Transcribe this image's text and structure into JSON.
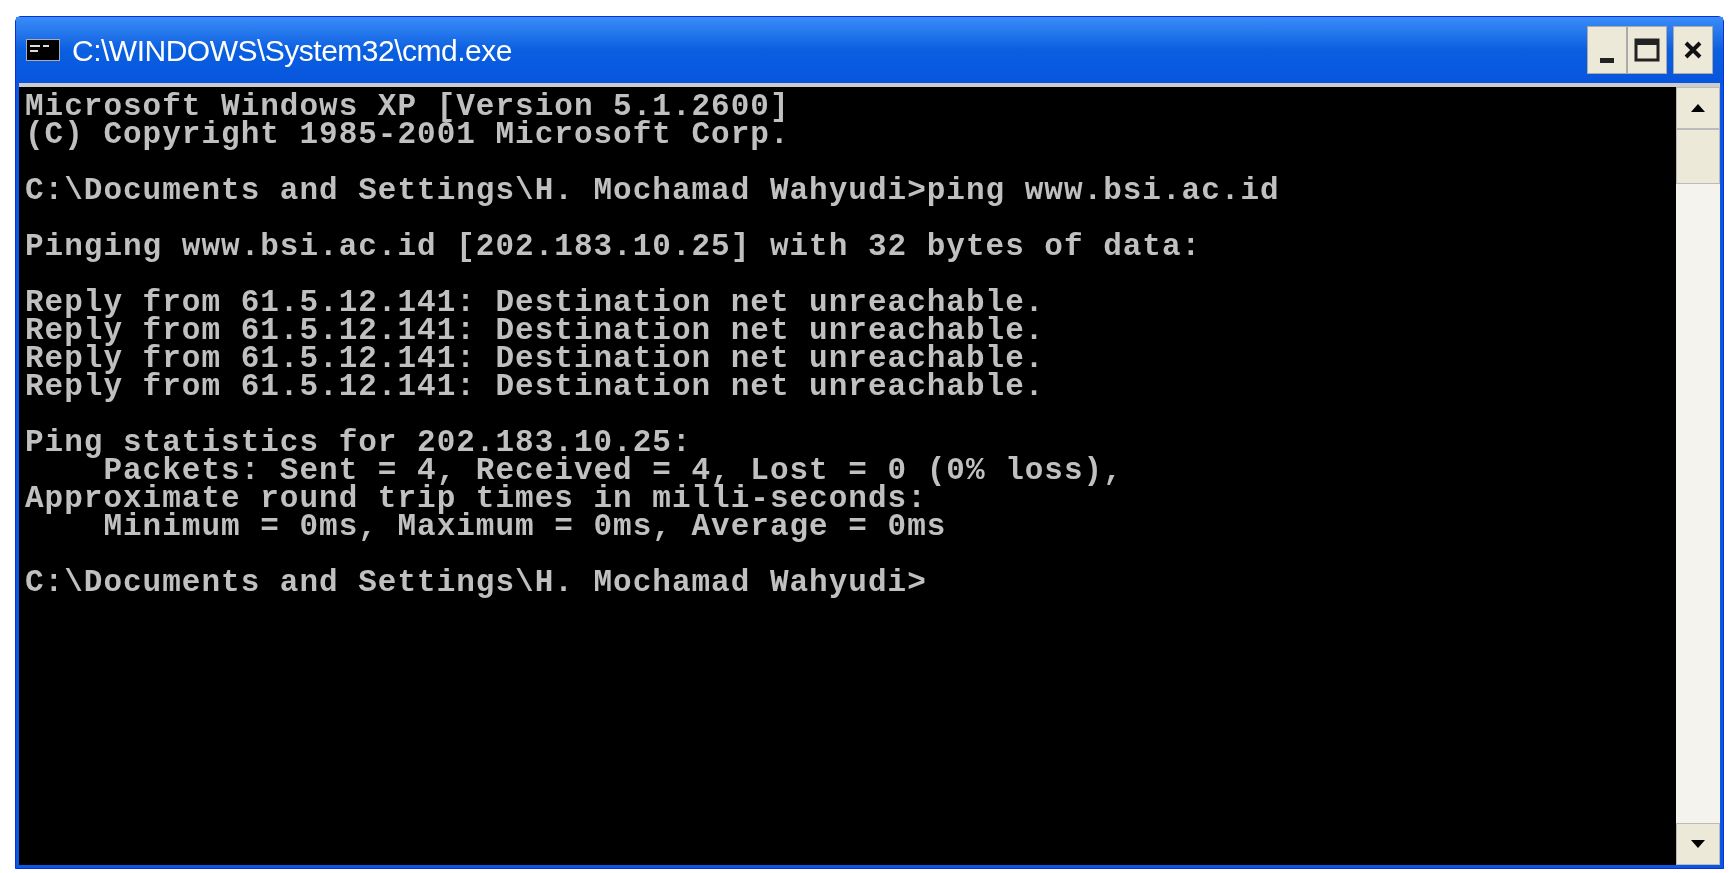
{
  "window": {
    "title": "C:\\WINDOWS\\System32\\cmd.exe"
  },
  "console": {
    "blocks": [
      [
        "Microsoft Windows XP [Version 5.1.2600]",
        "(C) Copyright 1985-2001 Microsoft Corp."
      ],
      [
        "C:\\Documents and Settings\\H. Mochamad Wahyudi>ping www.bsi.ac.id"
      ],
      [
        "Pinging www.bsi.ac.id [202.183.10.25] with 32 bytes of data:"
      ],
      [
        "Reply from 61.5.12.141: Destination net unreachable.",
        "Reply from 61.5.12.141: Destination net unreachable.",
        "Reply from 61.5.12.141: Destination net unreachable.",
        "Reply from 61.5.12.141: Destination net unreachable."
      ],
      [
        "Ping statistics for 202.183.10.25:",
        "    Packets: Sent = 4, Received = 4, Lost = 0 (0% loss),",
        "Approximate round trip times in milli-seconds:",
        "    Minimum = 0ms, Maximum = 0ms, Average = 0ms"
      ],
      [
        "C:\\Documents and Settings\\H. Mochamad Wahyudi>"
      ]
    ]
  }
}
